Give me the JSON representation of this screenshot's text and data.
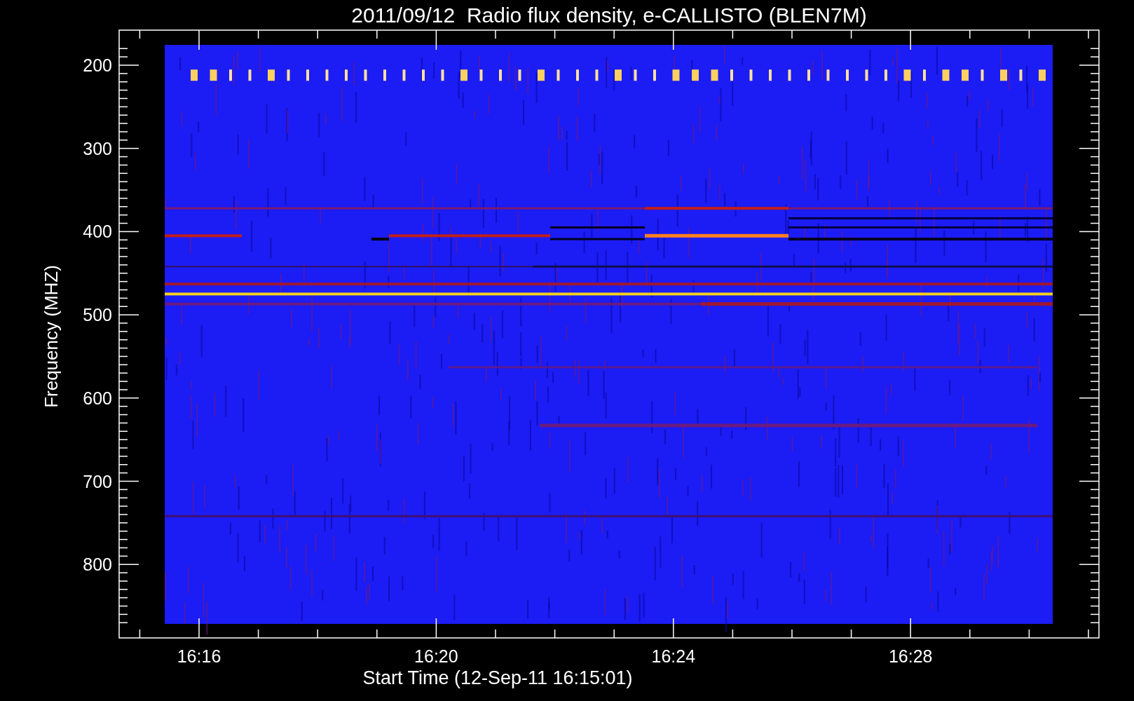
{
  "title": "2011/09/12  Radio flux density, e-CALLISTO (BLEN7M)",
  "plot": {
    "ylabel": "Frequency (MHZ)",
    "xlabel": "Start Time (12-Sep-11 16:15:01)",
    "yticks": [
      "200",
      "300",
      "400",
      "500",
      "600",
      "700",
      "800"
    ],
    "xticks": [
      "16:16",
      "16:20",
      "16:24",
      "16:28"
    ]
  }
}
